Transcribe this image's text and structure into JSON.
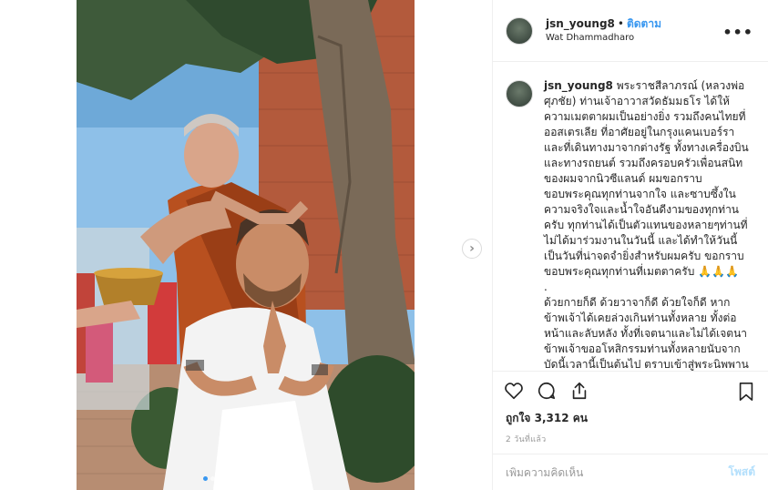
{
  "post": {
    "username": "jsn_young8",
    "separator": "•",
    "follow_label": "ติดตาม",
    "location": "Wat Dhammadharo",
    "more_label": "•••"
  },
  "caption": {
    "username": "jsn_young8",
    "text": " พระราชสีลาภรณ์ (หลวงพ่อศุภชัย) ท่านเจ้าอาวาสวัดธัมมธโร ได้ให้ความเมตตาผมเป็นอย่างยิ่ง รวมถึงคนไทยที่ออสเตรเลีย ที่อาศัยอยู่ในกรุงแคนเบอร์รา และที่เดินทางมาจากต่างรัฐ ทั้งทางเครื่องบินและทางรถยนต์ รวมถึงครอบครัวเพื่อนสนิทของผมจากนิวซีแลนด์ ผมขอกราบขอบพระคุณทุกท่านจากใจ และซาบซึ้งในความจริงใจและน้ำใจอันดีงามของทุกท่าน ครับ ทุกท่านได้เป็นตัวแทนของหลายๆท่านที่ไม่ได้มาร่วมงานในวันนี้ และได้ทำให้วันนี้เป็นวันที่น่าจดจำยิ่งสำหรับผมครับ ขอกราบขอบพระคุณทุกท่านที่เมตตาครับ 🙏🙏🙏\n.\nด้วยกายก็ดี ด้วยวาจาก็ดี ด้วยใจก็ดี หากข้าพเจ้าได้เคยล่วงเกินท่านทั้งหลาย ทั้งต่อหน้าและลับหลัง ทั้งที่เจตนาและไม่ได้เจตนา ข้าพเจ้าขออโหสิกรรมท่านทั้งหลายนับจากบัดนี้เวลานี้เป็นต้นไป ตราบเข้าสู่พระนิพพาน เทอญ 🙏🙏🙏"
  },
  "likes": {
    "text": "ถูกใจ 3,312 คน"
  },
  "timestamp": "2 วันที่แล้ว",
  "comment": {
    "placeholder": "เพิ่มความคิดเห็น",
    "post_label": "โพสต์"
  },
  "carousel": {
    "total": 12,
    "active_index": 0,
    "next_symbol": "›"
  },
  "colors": {
    "accent": "#3897f0",
    "post_disabled": "#b2dffc",
    "muted": "#999999",
    "border": "#efefef"
  },
  "icons": [
    "heart-icon",
    "comment-icon",
    "share-icon",
    "bookmark-icon",
    "chevron-right-icon",
    "more-icon"
  ]
}
